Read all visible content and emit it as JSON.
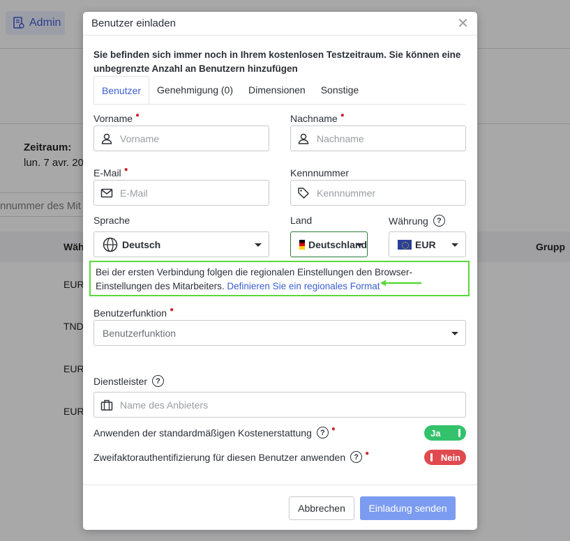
{
  "background": {
    "admin_label": "Admin",
    "period_label": "Zeitraum:",
    "period_value": "lun. 7 avr. 20",
    "search_fragment": "nnummer des Mit",
    "col_waehrung": "Wäh",
    "col_gruppe": "Grupp",
    "rows": [
      "EUR",
      "TND",
      "EUR",
      "EUR"
    ]
  },
  "modal": {
    "title": "Benutzer einladen",
    "intro": "Sie befinden sich immer noch in Ihrem kostenlosen Testzeitraum. Sie können eine unbegrenzte Anzahl an Benutzern hinzufügen",
    "tabs": [
      {
        "label": "Benutzer",
        "active": true
      },
      {
        "label": "Genehmigung (0)",
        "active": false
      },
      {
        "label": "Dimensionen",
        "active": false
      },
      {
        "label": "Sonstige",
        "active": false
      }
    ],
    "fields": {
      "vorname": {
        "label": "Vorname",
        "placeholder": "Vorname",
        "icon": "user-icon"
      },
      "nachname": {
        "label": "Nachname",
        "placeholder": "Nachname",
        "icon": "user-icon"
      },
      "email": {
        "label": "E-Mail",
        "placeholder": "E-Mail",
        "icon": "mail-icon"
      },
      "kennnummer": {
        "label": "Kennnummer",
        "placeholder": "Kennnummer",
        "icon": "tag-icon"
      },
      "sprache": {
        "label": "Sprache",
        "value": "Deutsch",
        "icon": "globe-icon"
      },
      "land": {
        "label": "Land",
        "value": "Deutschland",
        "flag": "germany-flag"
      },
      "waehrung": {
        "label": "Währung",
        "value": "EUR",
        "flag": "eu-flag"
      },
      "benutzerfunktion": {
        "label": "Benutzerfunktion",
        "placeholder": "Benutzerfunktion"
      },
      "dienstleister": {
        "label": "Dienstleister",
        "placeholder": "Name des Anbieters",
        "icon": "briefcase-icon"
      }
    },
    "notice": {
      "text": "Bei der ersten Verbindung folgen die regionalen Einstellungen den Browser-Einstellungen des Mitarbeiters.",
      "link": "Definieren Sie ein regionales Format",
      "highlight_color": "#5ad83a"
    },
    "toggles": {
      "kostenerstattung": {
        "label": "Anwenden der standardmäßigen Kostenerstattung",
        "value": "Ja",
        "color": "#33c26b"
      },
      "zweifaktor": {
        "label": "Zweifaktorauthentifizierung für diesen Benutzer anwenden",
        "value": "Nein",
        "color": "#e04a4f"
      }
    },
    "buttons": {
      "cancel": "Abbrechen",
      "send": "Einladung senden"
    },
    "accent_color": "#3b5fd1"
  }
}
